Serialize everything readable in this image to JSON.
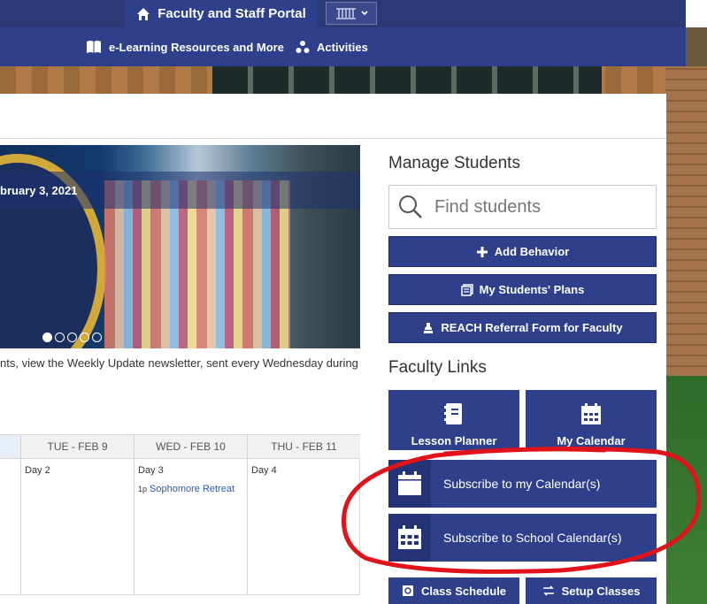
{
  "nav": {
    "portal_label": "Faculty and Staff Portal",
    "elearning_label": "e-Learning Resources and More",
    "activities_label": "Activities"
  },
  "carousel": {
    "caption": "bruary 3, 2021",
    "dots": 5,
    "active_dot": 0
  },
  "news_text": "nts, view the Weekly Update newsletter, sent every Wednesday during",
  "calendar": {
    "columns": [
      {
        "header": "",
        "day": "",
        "event_time": "",
        "event": ""
      },
      {
        "header": "TUE - FEB 9",
        "day": "Day 2",
        "event_time": "",
        "event": ""
      },
      {
        "header": "WED - FEB 10",
        "day": "Day 3",
        "event_time": "1p",
        "event": "Sophomore Retreat"
      },
      {
        "header": "THU - FEB 11",
        "day": "Day 4",
        "event_time": "",
        "event": ""
      }
    ]
  },
  "manage_students": {
    "title": "Manage Students",
    "search_placeholder": "Find students",
    "add_behavior": "Add Behavior",
    "my_students_plans": "My Students' Plans",
    "reach_referral": "REACH Referral Form for Faculty"
  },
  "faculty_links": {
    "title": "Faculty Links",
    "lesson_planner": "Lesson Planner",
    "my_calendar": "My Calendar",
    "subscribe_my": "Subscribe to my Calendar(s)",
    "subscribe_school": "Subscribe to School Calendar(s)",
    "class_schedule": "Class Schedule",
    "setup_classes": "Setup Classes"
  },
  "colors": {
    "primary": "#2e3f8c",
    "nav_dark": "#2b3a75",
    "annotation": "#e0131b"
  }
}
